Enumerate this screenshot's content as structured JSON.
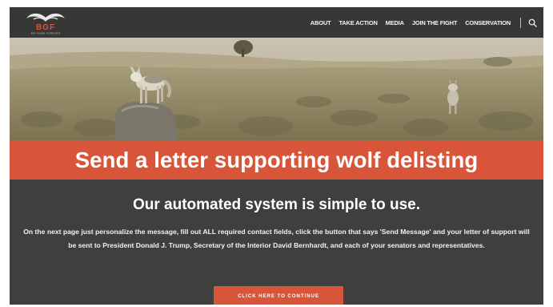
{
  "logo": {
    "text": "BGF",
    "tagline": "BIG GAME FOREVER",
    "accent_color": "#d9553a"
  },
  "nav": {
    "items": [
      {
        "label": "ABOUT"
      },
      {
        "label": "TAKE ACTION"
      },
      {
        "label": "MEDIA"
      },
      {
        "label": "JOIN THE FIGHT"
      },
      {
        "label": "CONSERVATION"
      }
    ],
    "search_icon": "search-icon"
  },
  "hero": {
    "image": "wolves-in-sagebrush-photo"
  },
  "headline": "Send a letter supporting wolf delisting",
  "content": {
    "subhead": "Our automated system is simple to use.",
    "body": "On the next page just personalize the message, fill out ALL required contact fields, click the button that says 'Send Message' and your letter of support will be sent to President Donald J. Trump, Secretary of the Interior David Bernhardt, and each of your senators and representatives.",
    "cta_label": "CLICK HERE TO CONTINUE"
  },
  "colors": {
    "accent": "#d9553a",
    "dark_bg": "#3f403d",
    "navbar_bg": "#373735"
  }
}
